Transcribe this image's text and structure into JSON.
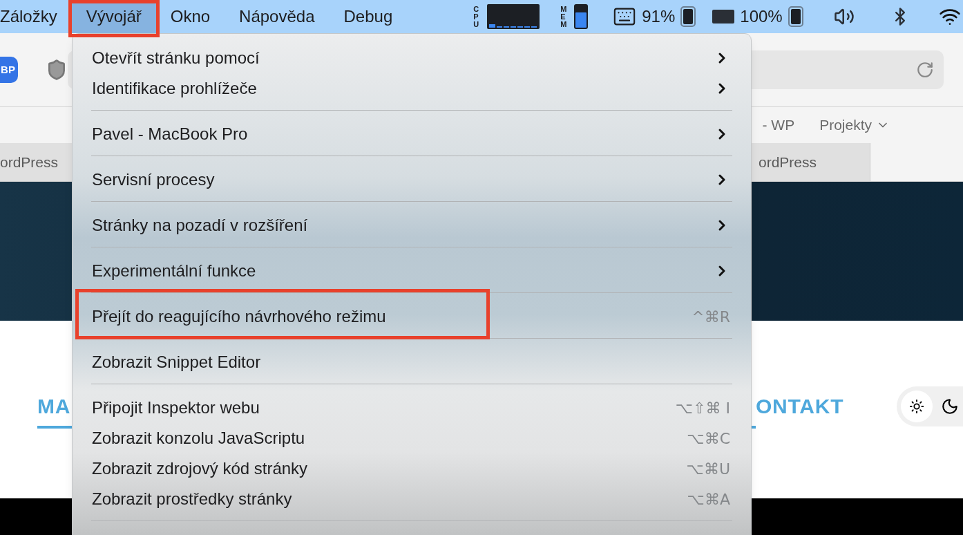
{
  "menubar": {
    "items": [
      {
        "label": "Záložky",
        "selected": false,
        "annotated": false
      },
      {
        "label": "Vývojář",
        "selected": true,
        "annotated": true
      },
      {
        "label": "Okno",
        "selected": false,
        "annotated": false
      },
      {
        "label": "Nápověda",
        "selected": false,
        "annotated": false
      },
      {
        "label": "Debug",
        "selected": false,
        "annotated": false
      }
    ],
    "status": {
      "cpu_label": "CPU",
      "mem_label": "MEM",
      "memory_meter": {
        "level": 0.7
      },
      "keyboard_battery": "91%",
      "device_battery": "100%"
    }
  },
  "browser": {
    "extension_badge": "BP",
    "bookmarks": [
      {
        "label": "- WP",
        "kind": "link"
      },
      {
        "label": "Projekty",
        "kind": "folder"
      }
    ],
    "tabs": [
      {
        "label": "ordPress"
      },
      {
        "label": "ordPress"
      }
    ],
    "page": {
      "nav": [
        {
          "label": "MA",
          "selected": true
        },
        {
          "label": "ONTAKT",
          "selected": false
        }
      ],
      "theme_options": [
        {
          "kind": "light",
          "selected": true
        },
        {
          "kind": "dark",
          "selected": false
        }
      ]
    }
  },
  "menu": {
    "groups": [
      {
        "items": [
          {
            "label": "Otevřít stránku pomocí",
            "kind": "submenu",
            "annotated": false
          },
          {
            "label": "Identifikace prohlížeče",
            "kind": "submenu",
            "annotated": false
          }
        ]
      },
      {
        "items": [
          {
            "label": "Pavel - MacBook Pro",
            "kind": "submenu",
            "annotated": false
          }
        ]
      },
      {
        "items": [
          {
            "label": "Servisní procesy",
            "kind": "submenu",
            "annotated": false
          }
        ]
      },
      {
        "items": [
          {
            "label": "Stránky na pozadí v rozšíření",
            "kind": "submenu",
            "annotated": false
          }
        ]
      },
      {
        "items": [
          {
            "label": "Experimentální funkce",
            "kind": "submenu",
            "annotated": false
          }
        ]
      },
      {
        "items": [
          {
            "label": "Přejít do reagujícího návrhového režimu",
            "kind": "shortcut",
            "shortcut": "^⌘R",
            "annotated": true
          }
        ]
      },
      {
        "items": [
          {
            "label": "Zobrazit Snippet Editor",
            "kind": "plain",
            "annotated": false
          }
        ]
      },
      {
        "items": [
          {
            "label": "Připojit Inspektor webu",
            "kind": "shortcut",
            "shortcut": "⌥⇧⌘ I",
            "annotated": false
          },
          {
            "label": "Zobrazit konzolu JavaScriptu",
            "kind": "shortcut",
            "shortcut": "⌥⌘C",
            "annotated": false
          },
          {
            "label": "Zobrazit zdrojový kód stránky",
            "kind": "shortcut",
            "shortcut": "⌥⌘U",
            "annotated": false
          },
          {
            "label": "Zobrazit prostředky stránky",
            "kind": "shortcut",
            "shortcut": "⌥⌘A",
            "annotated": false
          }
        ]
      }
    ]
  }
}
